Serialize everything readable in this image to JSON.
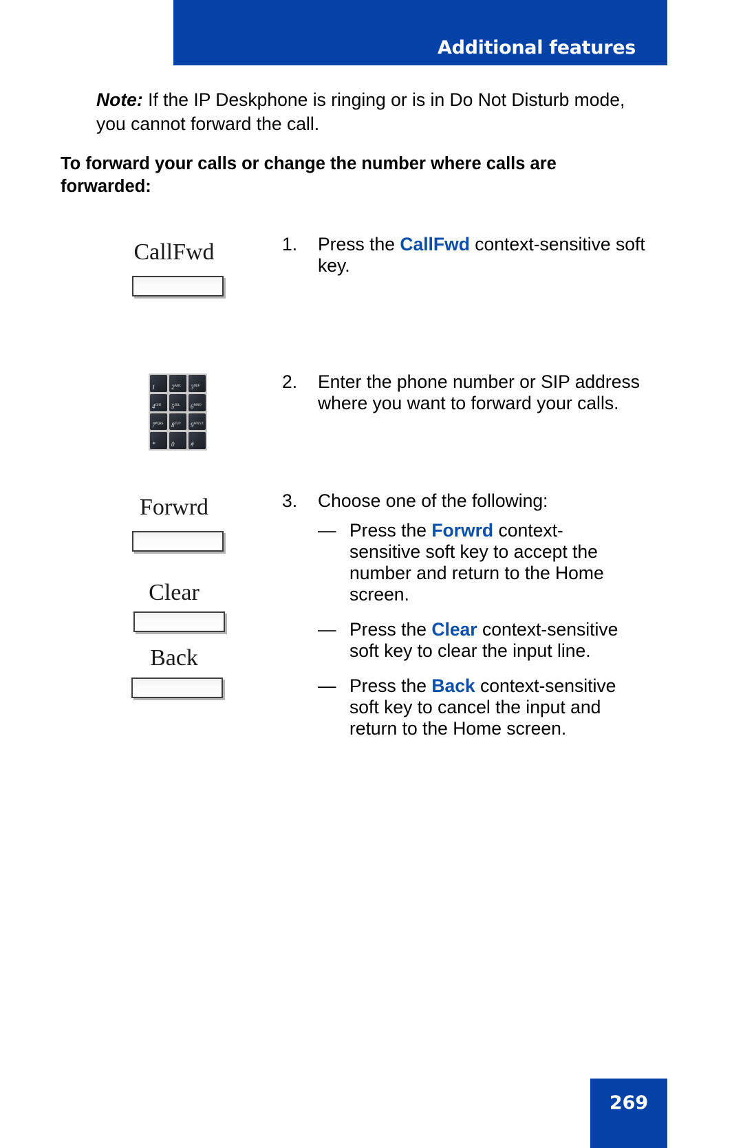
{
  "header": {
    "title": "Additional features",
    "banner_color": "#0542a8"
  },
  "note": {
    "label": "Note:",
    "text": " If the IP Deskphone is ringing or is in Do Not Disturb mode, you cannot forward the call."
  },
  "section_heading": "To forward your calls or change the number where calls are forwarded:",
  "accent_color": "#0b4fa8",
  "graphics": {
    "callfwd_label": "CallFwd",
    "forwrd_label": "Forwrd",
    "clear_label": "Clear",
    "back_label": "Back",
    "keypad": {
      "keys": [
        {
          "digit": "1",
          "letters": ""
        },
        {
          "digit": "2",
          "letters": "ABC"
        },
        {
          "digit": "3",
          "letters": "DEF"
        },
        {
          "digit": "4",
          "letters": "GHI"
        },
        {
          "digit": "5",
          "letters": "JKL"
        },
        {
          "digit": "6",
          "letters": "MNO"
        },
        {
          "digit": "7",
          "letters": "PQRS"
        },
        {
          "digit": "8",
          "letters": "TUV"
        },
        {
          "digit": "9",
          "letters": "WXYZ"
        },
        {
          "digit": "*",
          "letters": ""
        },
        {
          "digit": "0",
          "letters": ""
        },
        {
          "digit": "#",
          "letters": ""
        }
      ]
    }
  },
  "steps": [
    {
      "number": "1.",
      "prefix": "Press the ",
      "keyword": "CallFwd",
      "suffix": " context-sensitive soft key."
    },
    {
      "number": "2.",
      "prefix": "Enter the phone number or SIP address where you want to forward your calls.",
      "keyword": "",
      "suffix": ""
    },
    {
      "number": "3.",
      "prefix": "Choose one of the following:",
      "keyword": "",
      "suffix": ""
    }
  ],
  "sub_items": [
    {
      "dash": "—",
      "prefix": "Press the ",
      "keyword": "Forwrd",
      "suffix": " context-sensitive soft key to accept the number and return to the Home screen."
    },
    {
      "dash": "—",
      "prefix": "Press the ",
      "keyword": "Clear",
      "suffix": " context-sensitive soft key to clear the input line."
    },
    {
      "dash": "—",
      "prefix": "Press the ",
      "keyword": "Back",
      "suffix": " context-sensitive soft key to cancel the input and return to the Home screen."
    }
  ],
  "footer": {
    "page_number": "269"
  }
}
